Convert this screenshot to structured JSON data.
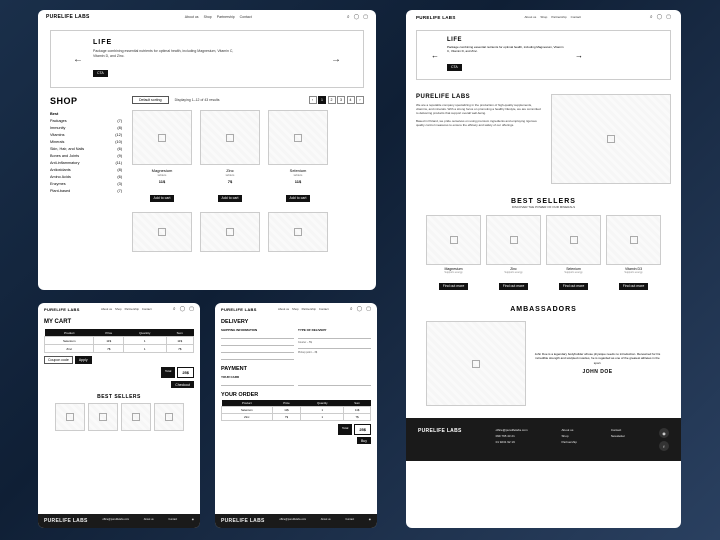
{
  "brand": "PURELIFE LABS",
  "nav": [
    "About us",
    "Shop",
    "Partnership",
    "Contact"
  ],
  "hero": {
    "title": "LIFE",
    "desc": "Package combining essential nutrients for optimal health, including Magnesium, Vitamin C, Vitamin D, and Zinc.",
    "cta": "CTA"
  },
  "shop": {
    "heading": "SHOP",
    "sort": "Default sorting",
    "results": "Displaying 1–12 of 43 results",
    "pages": [
      "1",
      "2",
      "3",
      "4"
    ],
    "categories": [
      {
        "n": "Best",
        "c": "",
        "b": true
      },
      {
        "n": "Packages",
        "c": "(7)"
      },
      {
        "n": "Immunity",
        "c": "(8)"
      },
      {
        "n": "Vitamins",
        "c": "(12)"
      },
      {
        "n": "Minerals",
        "c": "(10)"
      },
      {
        "n": "Skin, Hair, and Nails",
        "c": "(6)"
      },
      {
        "n": "Bones and Joints",
        "c": "(9)"
      },
      {
        "n": "Anti-inflammatory",
        "c": "(11)"
      },
      {
        "n": "Antioxidants",
        "c": "(8)"
      },
      {
        "n": "Amino Acids",
        "c": "(6)"
      },
      {
        "n": "Enzymes",
        "c": "(3)"
      },
      {
        "n": "Plant-based",
        "c": "(7)"
      }
    ],
    "products": [
      {
        "n": "Magnesium",
        "s": "tablets",
        "p": "11$"
      },
      {
        "n": "Zinc",
        "s": "tablets",
        "p": "7$"
      },
      {
        "n": "Selenium",
        "s": "tablets",
        "p": "11$"
      }
    ],
    "add": "Add to cart"
  },
  "cart": {
    "heading": "MY CART",
    "cols": [
      "Product",
      "Price",
      "Quantity",
      "Sum"
    ],
    "rows": [
      [
        "Selenium",
        "11$",
        "1",
        "11$"
      ],
      [
        "Zinc",
        "7$",
        "1",
        "7$"
      ]
    ],
    "coupon": "Coupon code",
    "apply": "Apply",
    "totalLabel": "Total",
    "total": "25$",
    "checkout": "Checkout",
    "bsHeading": "BEST SELLERS"
  },
  "checkout": {
    "delivery": "DELIVERY",
    "ship": "SHIPPING INFORMATION",
    "type": "TYPE OF DELIVERY",
    "payment": "PAYMENT",
    "card": "YOUR CARD",
    "order": "YOUR ORDER",
    "cols": [
      "Product",
      "Price",
      "Quantity",
      "Sum"
    ],
    "rows": [
      [
        "Selenium",
        "11$",
        "1",
        "11$"
      ],
      [
        "Zinc",
        "7$",
        "1",
        "7$"
      ]
    ],
    "totalLabel": "Total",
    "total": "25$",
    "buy": "Buy"
  },
  "home": {
    "aboutTitle": "PURELIFE LABS",
    "aboutP1": "We are a reputable company specializing in the production of high-quality supplements, vitamins, and minerals. With a strong focus on promoting a healthy lifestyle, we are committed to delivering products that support overall well-being.",
    "aboutP2": "Based in Poland, we pride ourselves on using premium ingredients and employing rigorous quality control measures to ensure the efficacy and safety of our offerings.",
    "bsHeading": "BEST SELLERS",
    "bsSub": "DISCOVER THE POWER OF OUR MINERALS",
    "bs": [
      {
        "n": "Magnesium",
        "s": "Supports energy"
      },
      {
        "n": "Zinc",
        "s": "Supports energy"
      },
      {
        "n": "Selenium",
        "s": "Supports energy"
      },
      {
        "n": "Vitamin D3",
        "s": "Supports energy"
      }
    ],
    "more": "Find out more",
    "ambHeading": "AMBASSADORS",
    "ambText": "John Doe is a legendary bodybuilder whose physique needs no introduction. Renowned for his incredible strength and sculpted muscles, he is regarded as one of the greatest athletes in the sport.",
    "ambName": "JOHN DOE"
  },
  "footer": {
    "email": "office@purelifelabs.com",
    "phone1": "099 765 43 21",
    "phone2": "01 9231 92 19",
    "links1": [
      "About us",
      "Shop",
      "Partnership"
    ],
    "links2": [
      "Contact",
      "Newsletter"
    ]
  }
}
